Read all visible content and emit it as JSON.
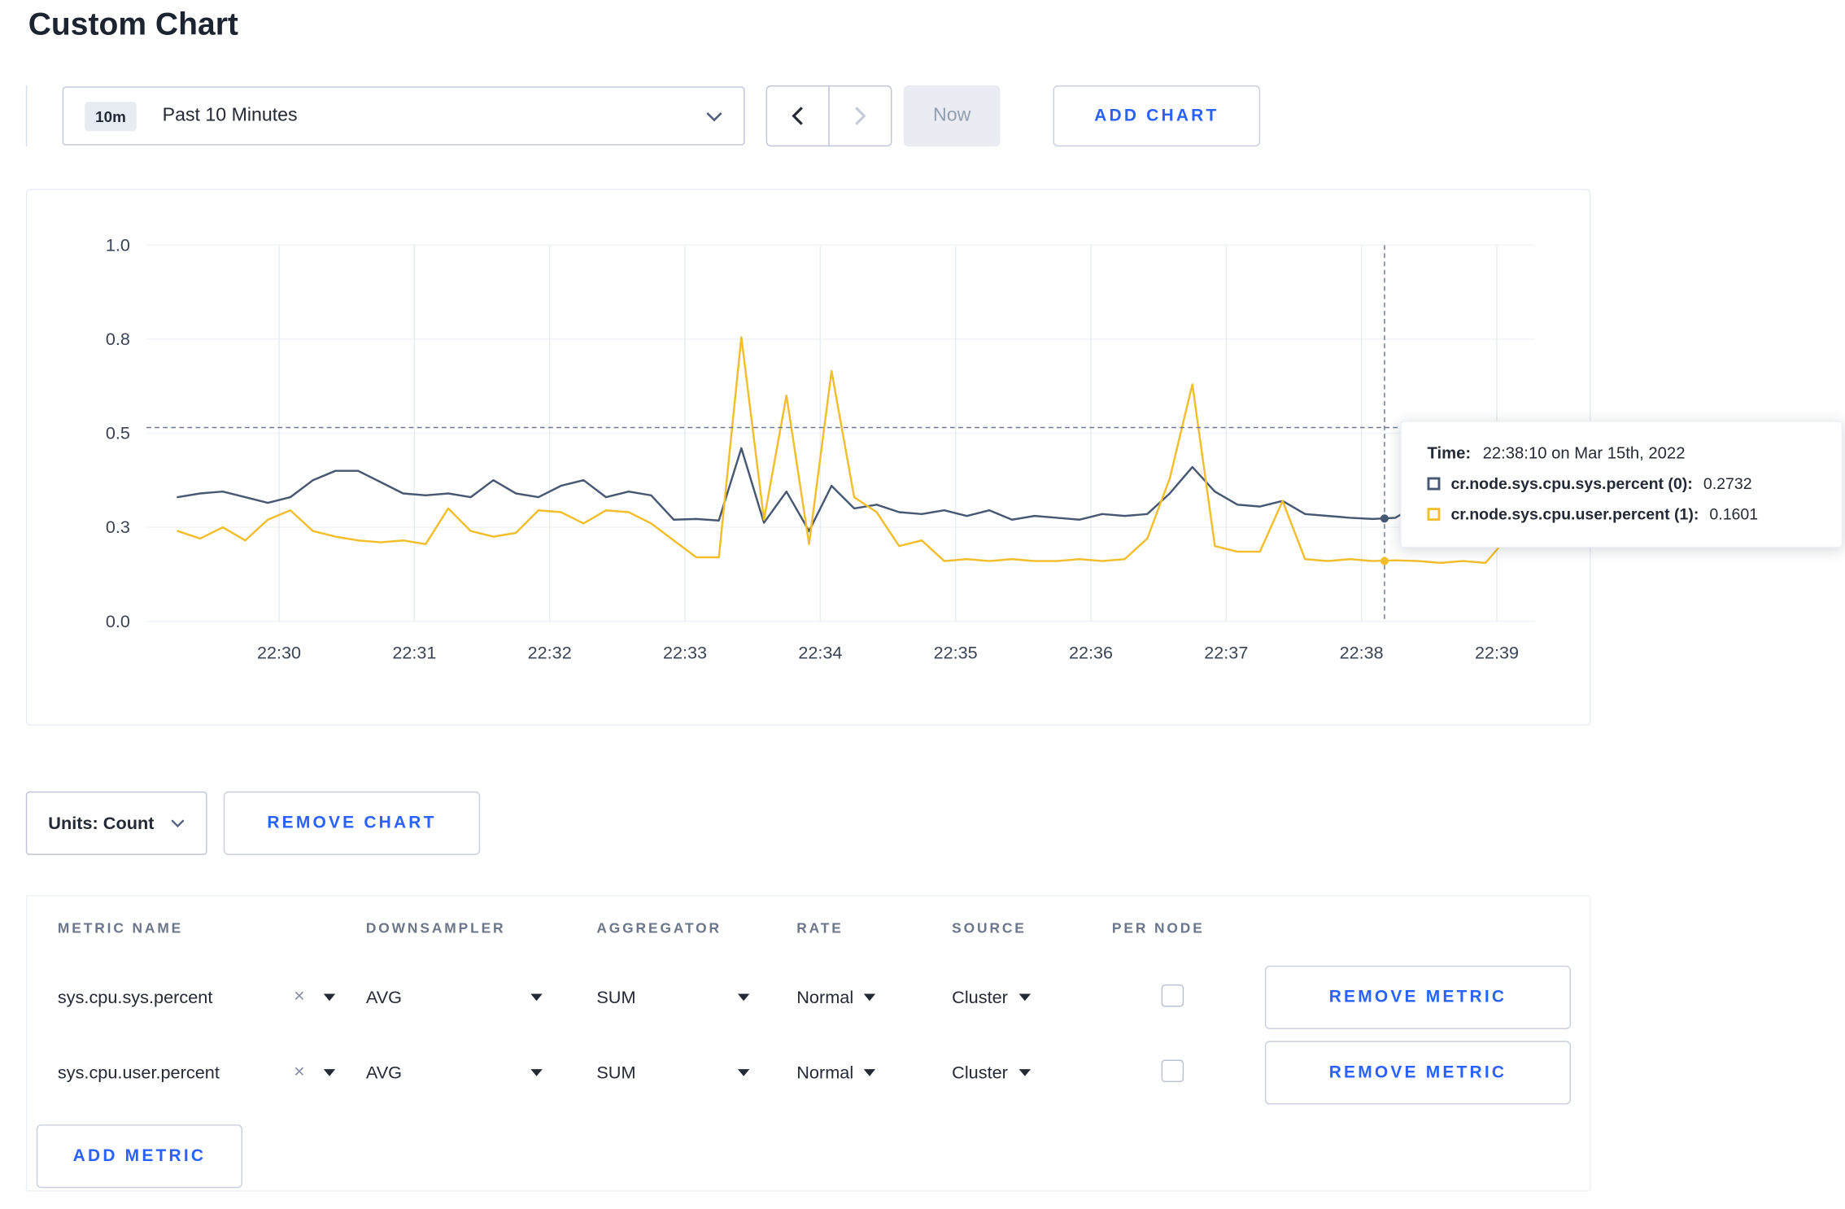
{
  "page": {
    "title": "Custom Chart"
  },
  "colors": {
    "accent_blue": "#2962ff",
    "series_sys": "#475872",
    "series_user": "#f2be2c"
  },
  "toolbar": {
    "time_window_badge": "10m",
    "time_window_label": "Past 10 Minutes",
    "now_label": "Now",
    "add_chart_label": "ADD CHART"
  },
  "chart_controls": {
    "units_label": "Units: Count",
    "remove_chart_label": "REMOVE CHART"
  },
  "tooltip": {
    "time_label": "Time:",
    "time_value": "22:38:10 on Mar 15th, 2022",
    "series": [
      {
        "name": "cr.node.sys.cpu.sys.percent (0):",
        "value": "0.2732",
        "color": "#475872"
      },
      {
        "name": "cr.node.sys.cpu.user.percent (1):",
        "value": "0.1601",
        "color": "#f2be2c"
      }
    ]
  },
  "metrics_table": {
    "headers": [
      "METRIC NAME",
      "DOWNSAMPLER",
      "AGGREGATOR",
      "RATE",
      "SOURCE",
      "PER NODE"
    ],
    "rows": [
      {
        "metric": "sys.cpu.sys.percent",
        "downsampler": "AVG",
        "aggregator": "SUM",
        "rate": "Normal",
        "source": "Cluster",
        "per_node_checked": false,
        "action_label": "REMOVE METRIC"
      },
      {
        "metric": "sys.cpu.user.percent",
        "downsampler": "AVG",
        "aggregator": "SUM",
        "rate": "Normal",
        "source": "Cluster",
        "per_node_checked": false,
        "action_label": "REMOVE METRIC"
      }
    ],
    "add_metric_label": "ADD METRIC"
  },
  "icons": {
    "clear_metric": "×"
  },
  "chart_data": {
    "type": "line",
    "title": "",
    "x_axis": {
      "tick_labels": [
        "22:30",
        "22:31",
        "22:32",
        "22:33",
        "22:34",
        "22:35",
        "22:36",
        "22:37",
        "22:38",
        "22:39"
      ],
      "tick_minutes": [
        0,
        1,
        2,
        3,
        4,
        5,
        6,
        7,
        8,
        9
      ],
      "domain_minutes": [
        -0.98,
        9.28
      ]
    },
    "y_axis": {
      "ticks": [
        {
          "label": "0.0",
          "value": 0
        },
        {
          "label": "0.3",
          "value": 0.25
        },
        {
          "label": "0.5",
          "value": 0.5
        },
        {
          "label": "0.8",
          "value": 0.75
        },
        {
          "label": "1.0",
          "value": 1
        }
      ],
      "domain": [
        0,
        1
      ]
    },
    "sample_interval_minutes": 0.166667,
    "series": [
      {
        "name": "cr.node.sys.cpu.sys.percent",
        "color": "#475872",
        "start_minute": -0.75,
        "values": [
          0.33,
          0.34,
          0.345,
          0.33,
          0.315,
          0.33,
          0.375,
          0.4,
          0.4,
          0.37,
          0.34,
          0.335,
          0.34,
          0.33,
          0.375,
          0.34,
          0.33,
          0.36,
          0.375,
          0.33,
          0.345,
          0.335,
          0.27,
          0.272,
          0.268,
          0.46,
          0.262,
          0.345,
          0.24,
          0.36,
          0.3,
          0.31,
          0.29,
          0.285,
          0.295,
          0.28,
          0.295,
          0.27,
          0.28,
          0.275,
          0.27,
          0.285,
          0.28,
          0.285,
          0.34,
          0.41,
          0.345,
          0.31,
          0.305,
          0.32,
          0.285,
          0.28,
          0.275,
          0.272,
          0.275,
          0.31,
          0.3,
          0.295,
          0.3,
          0.31,
          0.3
        ]
      },
      {
        "name": "cr.node.sys.cpu.user.percent",
        "color": "#f2be2c",
        "start_minute": -0.75,
        "values": [
          0.24,
          0.22,
          0.25,
          0.215,
          0.27,
          0.295,
          0.24,
          0.225,
          0.215,
          0.21,
          0.215,
          0.205,
          0.3,
          0.24,
          0.225,
          0.235,
          0.295,
          0.29,
          0.26,
          0.295,
          0.29,
          0.26,
          0.215,
          0.17,
          0.17,
          0.755,
          0.27,
          0.6,
          0.205,
          0.665,
          0.33,
          0.29,
          0.2,
          0.215,
          0.16,
          0.165,
          0.16,
          0.165,
          0.16,
          0.16,
          0.165,
          0.16,
          0.165,
          0.22,
          0.38,
          0.63,
          0.2,
          0.185,
          0.185,
          0.32,
          0.165,
          0.16,
          0.165,
          0.16,
          0.162,
          0.16,
          0.155,
          0.16,
          0.155,
          0.225,
          0.27
        ]
      }
    ],
    "crosshair": {
      "time_minute": 8.17,
      "hline_value": 0.515,
      "points": [
        {
          "value": 0.2732,
          "color": "#475872"
        },
        {
          "value": 0.1601,
          "color": "#f2be2c"
        }
      ]
    },
    "legend_position": "tooltip",
    "grid": true
  }
}
